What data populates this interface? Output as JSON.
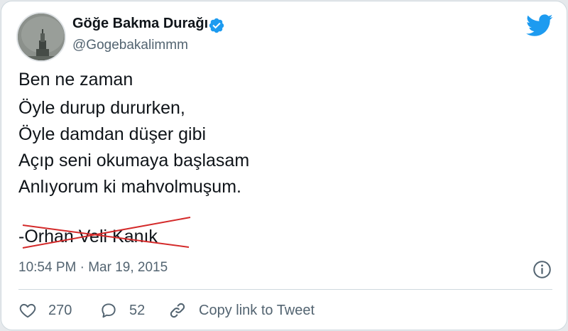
{
  "author": {
    "display_name": "Göğe Bakma Durağı",
    "handle": "@Gogebakalimmm",
    "verified": true
  },
  "tweet": {
    "lines": [
      "Ben ne zaman",
      "Öyle durup dururken,",
      "Öyle damdan düşer gibi",
      "Açıp seni okumaya başlasam",
      "Anlıyorum ki mahvolmuşum."
    ],
    "signature": "-Orhan Veli Kanık",
    "signature_struck_through": true
  },
  "meta": {
    "timestamp": "10:54 PM · Mar 19, 2015"
  },
  "actions": {
    "like_count": "270",
    "reply_count": "52",
    "copy_link_label": "Copy link to Tweet"
  },
  "icons": {
    "brand": "twitter-bird-icon",
    "verified": "verified-badge-icon",
    "info": "info-icon",
    "like": "heart-icon",
    "reply": "comment-icon",
    "copy": "link-icon"
  },
  "colors": {
    "brand_blue": "#1d9bf0",
    "text_primary": "#0f1419",
    "text_secondary": "#536471",
    "strike_red": "#d42a2a"
  }
}
